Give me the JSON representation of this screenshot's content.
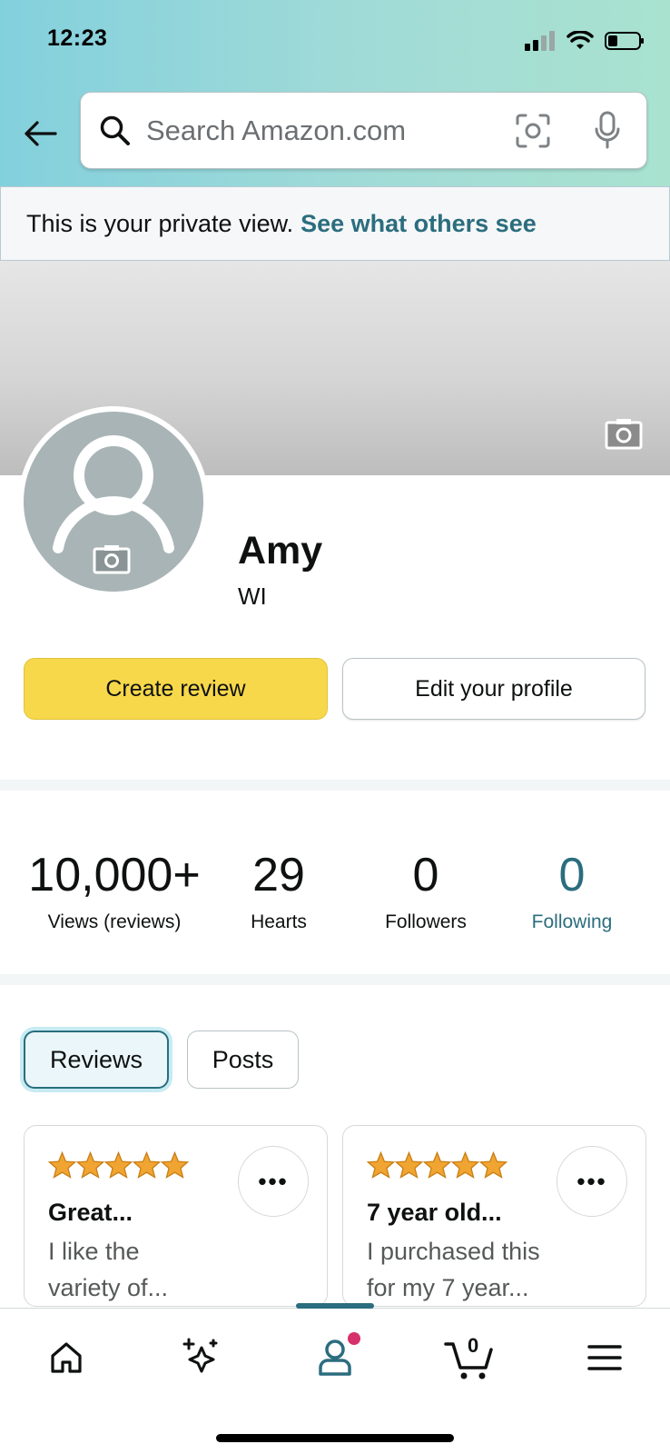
{
  "status_bar": {
    "time": "12:23"
  },
  "search": {
    "placeholder": "Search Amazon.com"
  },
  "private_banner": {
    "text": "This is your private view.",
    "link": "See what others see"
  },
  "profile": {
    "name": "Amy",
    "location": "WI"
  },
  "actions": {
    "create_review": "Create review",
    "edit_profile": "Edit your profile"
  },
  "stats": [
    {
      "value": "10,000+",
      "label": "Views (reviews)"
    },
    {
      "value": "29",
      "label": "Hearts"
    },
    {
      "value": "0",
      "label": "Followers"
    },
    {
      "value": "0",
      "label": "Following"
    }
  ],
  "tabs": {
    "reviews": "Reviews",
    "posts": "Posts",
    "selected": "Reviews"
  },
  "reviews": [
    {
      "rating": 5,
      "title": "Great...",
      "line1": "I like the",
      "line2": "variety of..."
    },
    {
      "rating": 5,
      "title": "7 year old...",
      "line1": "I purchased this",
      "line2": "for my 7 year..."
    }
  ],
  "bottom_nav": {
    "items": [
      "home-icon",
      "sparkle-icon",
      "profile-icon",
      "cart-icon",
      "menu-icon"
    ],
    "active": "profile-icon",
    "cart_count": "0"
  },
  "colors": {
    "accent": "#2b6d7e",
    "create_button": "#f7d84a",
    "star": "#f0a431",
    "badge": "#d6316a"
  }
}
